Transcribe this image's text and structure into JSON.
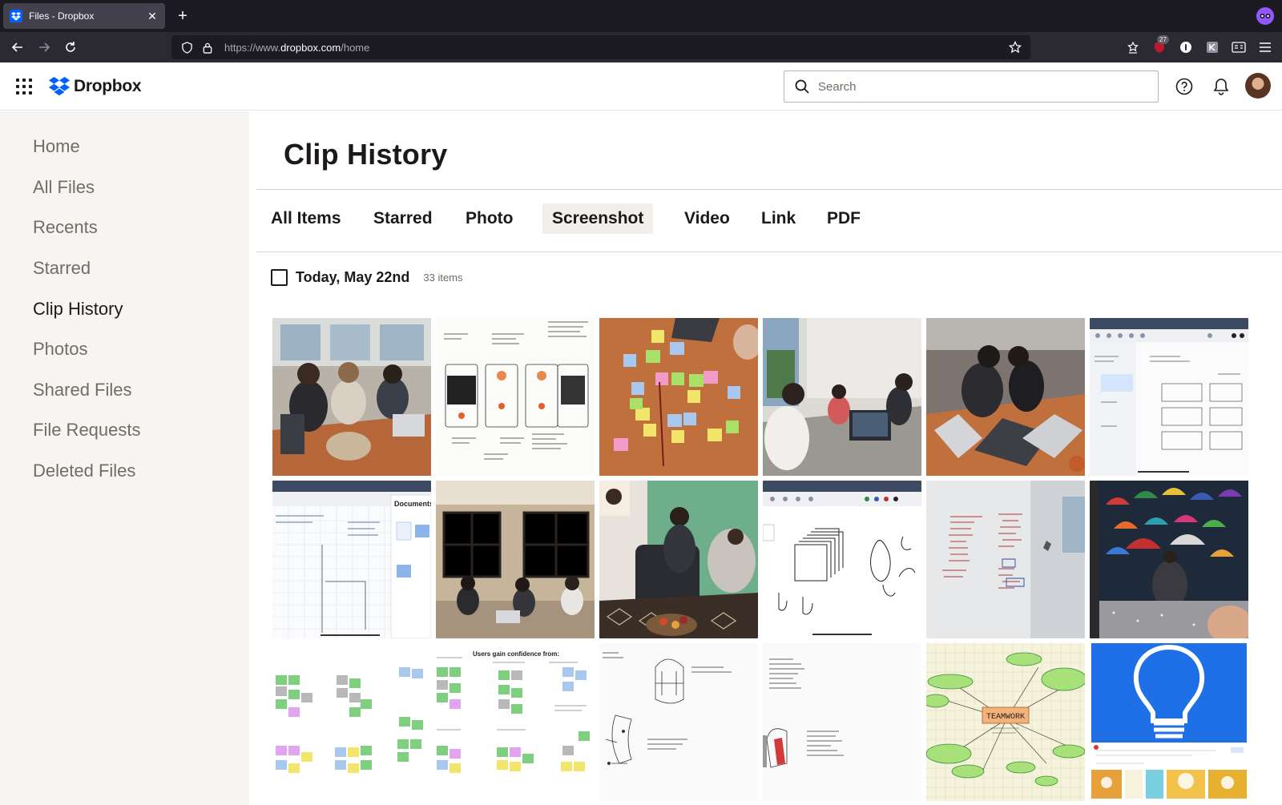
{
  "browser": {
    "tab_title": "Files - Dropbox",
    "url_prefix": "https://www.",
    "url_host": "dropbox.com",
    "url_path": "/home",
    "extension_badge": "27"
  },
  "header": {
    "logo_text": "Dropbox",
    "search_placeholder": "Search"
  },
  "sidebar": {
    "items": [
      {
        "label": "Home"
      },
      {
        "label": "All Files"
      },
      {
        "label": "Recents"
      },
      {
        "label": "Starred"
      },
      {
        "label": "Clip History",
        "active": true
      },
      {
        "label": "Photos"
      },
      {
        "label": "Shared Files"
      },
      {
        "label": "File Requests"
      },
      {
        "label": "Deleted Files"
      }
    ]
  },
  "main": {
    "title": "Clip History",
    "filter_tabs": [
      {
        "label": "All Items"
      },
      {
        "label": "Starred"
      },
      {
        "label": "Photo"
      },
      {
        "label": "Screenshot",
        "active": true
      },
      {
        "label": "Video"
      },
      {
        "label": "Link"
      },
      {
        "label": "PDF"
      }
    ],
    "day_group": {
      "label": "Today, May 22nd",
      "count": "33 items"
    },
    "thumbnails": [
      {
        "kind": "classroom-photo"
      },
      {
        "kind": "sketch-wireframes"
      },
      {
        "kind": "sticky-notes-table"
      },
      {
        "kind": "video-call-room"
      },
      {
        "kind": "laptop-collaboration"
      },
      {
        "kind": "notes-app-screenshot"
      },
      {
        "kind": "documents-app-screenshot",
        "label": "Documents"
      },
      {
        "kind": "study-room-windows"
      },
      {
        "kind": "living-room-video-call"
      },
      {
        "kind": "drawing-app-sketch"
      },
      {
        "kind": "whiteboard-notes"
      },
      {
        "kind": "umbrella-painting"
      },
      {
        "kind": "affinity-diagram",
        "label": "Users gain confidence from:"
      },
      {
        "kind": "backpack-sketch"
      },
      {
        "kind": "product-sketch"
      },
      {
        "kind": "teamwork-mindmap",
        "label": "TEAMWORK"
      },
      {
        "kind": "lightbulb-screenshot"
      }
    ]
  },
  "colors": {
    "brand_blue": "#0061fe",
    "sidebar_bg": "#f7f5f2",
    "text_primary": "#1e1919",
    "text_secondary": "#736c64"
  }
}
